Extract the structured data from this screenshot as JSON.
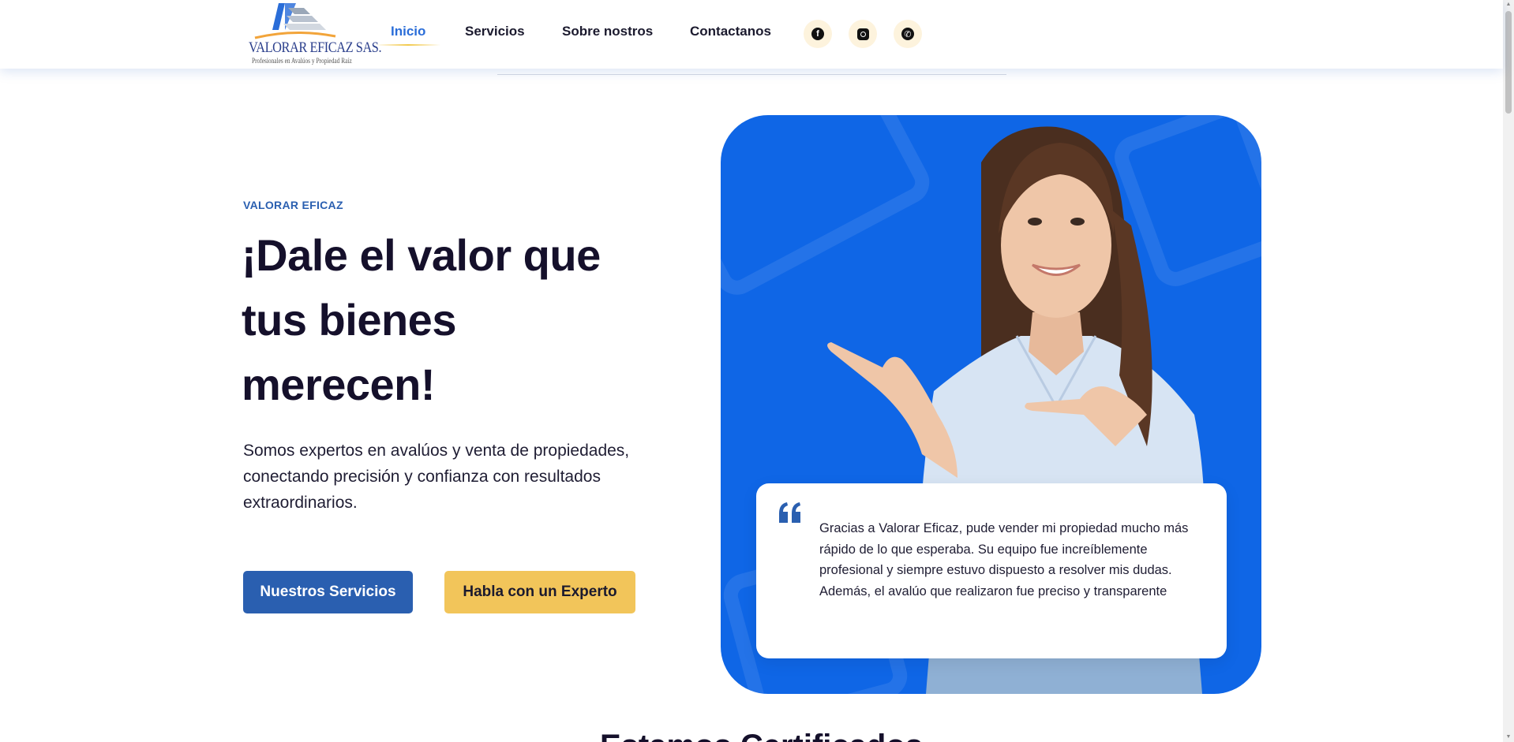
{
  "header": {
    "logo": {
      "brand": "VALORAR EFICAZ SAS.",
      "tagline": "Profesionales en Avalúos y Propiedad Raíz"
    },
    "nav": [
      {
        "label": "Inicio",
        "active": true
      },
      {
        "label": "Servicios",
        "active": false
      },
      {
        "label": "Sobre nostros",
        "active": false
      },
      {
        "label": "Contactanos",
        "active": false
      }
    ],
    "social": [
      {
        "icon": "facebook-icon",
        "glyph": "f"
      },
      {
        "icon": "instagram-icon",
        "glyph": ""
      },
      {
        "icon": "whatsapp-icon",
        "glyph": "✆"
      }
    ]
  },
  "hero": {
    "eyebrow": "VALORAR EFICAZ",
    "headline": "¡Dale el valor que tus bienes merecen!",
    "description": "Somos expertos en avalúos y venta de propiedades, conectando precisión y confianza con resultados extraordinarios.",
    "primary_button": "Nuestros Servicios",
    "secondary_button": "Habla con un Experto",
    "testimonial": "Gracias a Valorar Eficaz, pude vender mi propiedad mucho más rápido de lo que esperaba. Su equipo fue increíblemente profesional y siempre estuvo dispuesto a resolver mis dudas. Además, el avalúo que realizaron fue preciso y transparente"
  },
  "next_section": {
    "title": "Estamos Certificados"
  },
  "colors": {
    "accent_blue": "#2a5fb0",
    "card_blue": "#0f66e6",
    "accent_yellow": "#f2c55a",
    "nav_active": "#2a6dd8",
    "headline": "#15102b"
  }
}
